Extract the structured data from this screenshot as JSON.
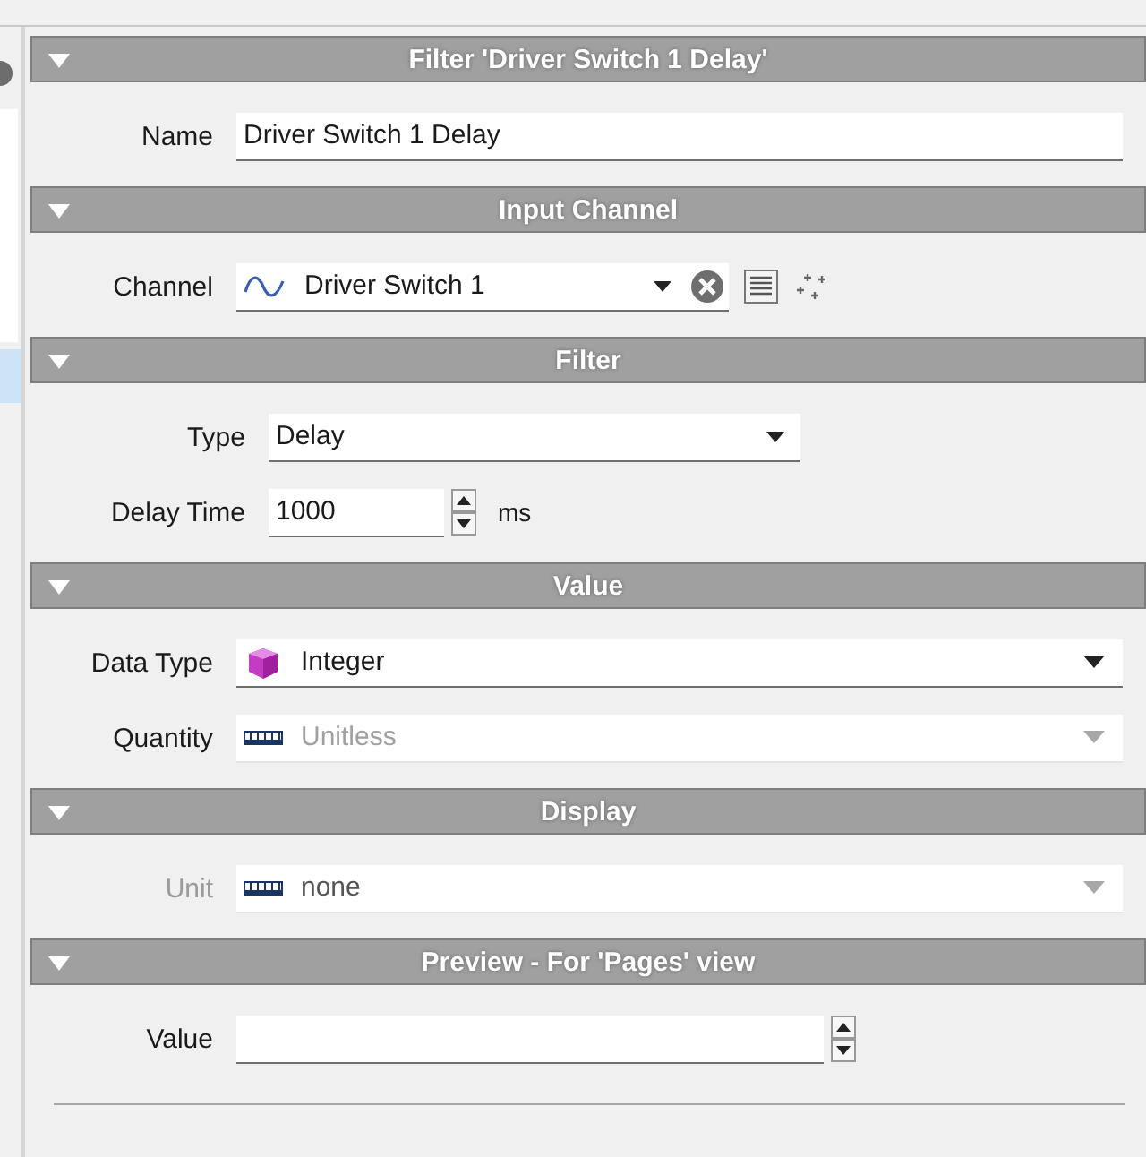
{
  "sections": [
    {
      "title": "Filter 'Driver Switch 1 Delay'",
      "expanded": true,
      "rows": [
        {
          "kind": "text",
          "label": "Name",
          "value": "Driver Switch 1 Delay",
          "disabled": false,
          "label_disabled": false
        }
      ]
    },
    {
      "title": "Input Channel",
      "expanded": true,
      "rows": [
        {
          "kind": "channel",
          "label": "Channel",
          "value": "Driver Switch 1",
          "disabled": false,
          "label_disabled": false
        }
      ]
    },
    {
      "title": "Filter",
      "expanded": true,
      "rows": [
        {
          "kind": "select",
          "label": "Type",
          "value": "Delay",
          "disabled": false,
          "label_disabled": false
        },
        {
          "kind": "number",
          "label": "Delay Time",
          "value": "1000",
          "unit": "ms",
          "disabled": false,
          "label_disabled": false
        }
      ]
    },
    {
      "title": "Value",
      "expanded": true,
      "rows": [
        {
          "kind": "datatype",
          "label": "Data Type",
          "value": "Integer",
          "disabled": false,
          "label_disabled": false
        },
        {
          "kind": "measure",
          "label": "Quantity",
          "value": "Unitless",
          "disabled": true,
          "label_disabled": false
        }
      ]
    },
    {
      "title": "Display",
      "expanded": true,
      "rows": [
        {
          "kind": "measure",
          "label": "Unit",
          "value": "none",
          "disabled": true,
          "label_disabled": true
        }
      ]
    },
    {
      "title": "Preview - For 'Pages' view",
      "expanded": true,
      "rows": [
        {
          "kind": "spin",
          "label": "Value",
          "value": "",
          "disabled": false,
          "label_disabled": false
        }
      ]
    }
  ]
}
